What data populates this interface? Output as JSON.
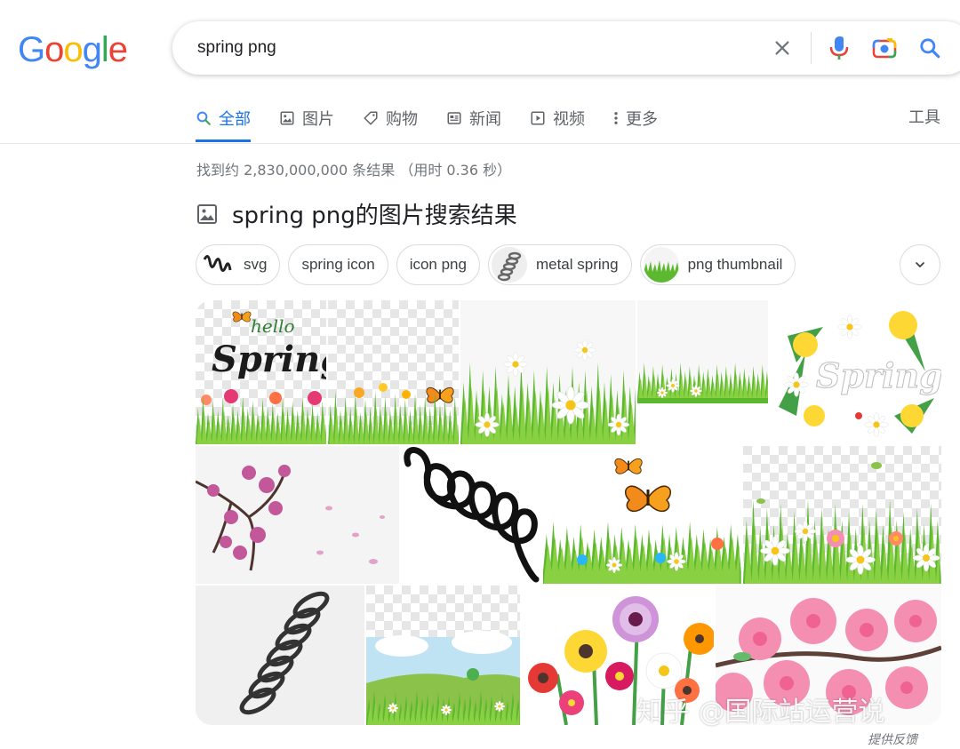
{
  "logo": {
    "letters": [
      "G",
      "o",
      "o",
      "g",
      "l",
      "e"
    ],
    "colors": [
      "#4285f4",
      "#ea4335",
      "#fbbc05",
      "#4285f4",
      "#34a853",
      "#ea4335"
    ]
  },
  "search": {
    "query": "spring png"
  },
  "tabs": [
    {
      "label": "全部",
      "icon": "search-icon",
      "active": true
    },
    {
      "label": "图片",
      "icon": "image-icon"
    },
    {
      "label": "购物",
      "icon": "tag-icon"
    },
    {
      "label": "新闻",
      "icon": "news-icon"
    },
    {
      "label": "视频",
      "icon": "play-icon"
    },
    {
      "label": "更多",
      "icon": "more-vert-icon"
    }
  ],
  "tools_label": "工具",
  "result_stats": "找到约 2,830,000,000 条结果 （用时 0.36 秒）",
  "images_heading": "spring png的图片搜索结果",
  "chips": [
    {
      "label": "svg",
      "thumb": "coil-spring"
    },
    {
      "label": "spring icon"
    },
    {
      "label": "icon png"
    },
    {
      "label": "metal spring",
      "thumb": "metal-spring"
    },
    {
      "label": "png thumbnail",
      "thumb": "grass"
    }
  ],
  "images": [
    {
      "alt": "hello Spring",
      "kind": "hello-spring"
    },
    {
      "alt": "grass butterfly transparent",
      "kind": "grass-butterfly"
    },
    {
      "alt": "daisies grass",
      "kind": "daisies"
    },
    {
      "alt": "small grass strip",
      "kind": "grass-strip"
    },
    {
      "alt": "Spring flowers",
      "kind": "spring-flowers"
    },
    {
      "alt": "cherry blossom",
      "kind": "cherry"
    },
    {
      "alt": "coil spring",
      "kind": "coil"
    },
    {
      "alt": "butterflies flowers",
      "kind": "butterflies"
    },
    {
      "alt": "daisy border",
      "kind": "daisy-border"
    },
    {
      "alt": "metal spring",
      "kind": "metal"
    },
    {
      "alt": "meadow landscape",
      "kind": "meadow"
    },
    {
      "alt": "gerbera flowers",
      "kind": "gerbera"
    },
    {
      "alt": "pink blossom",
      "kind": "pink-blossom"
    }
  ],
  "watermark": "知乎 @国际站运营说",
  "feedback": "提供反馈",
  "colors": {
    "accent": "#1a73e8",
    "grass": "#5cb82e",
    "text_muted": "#70757a"
  }
}
